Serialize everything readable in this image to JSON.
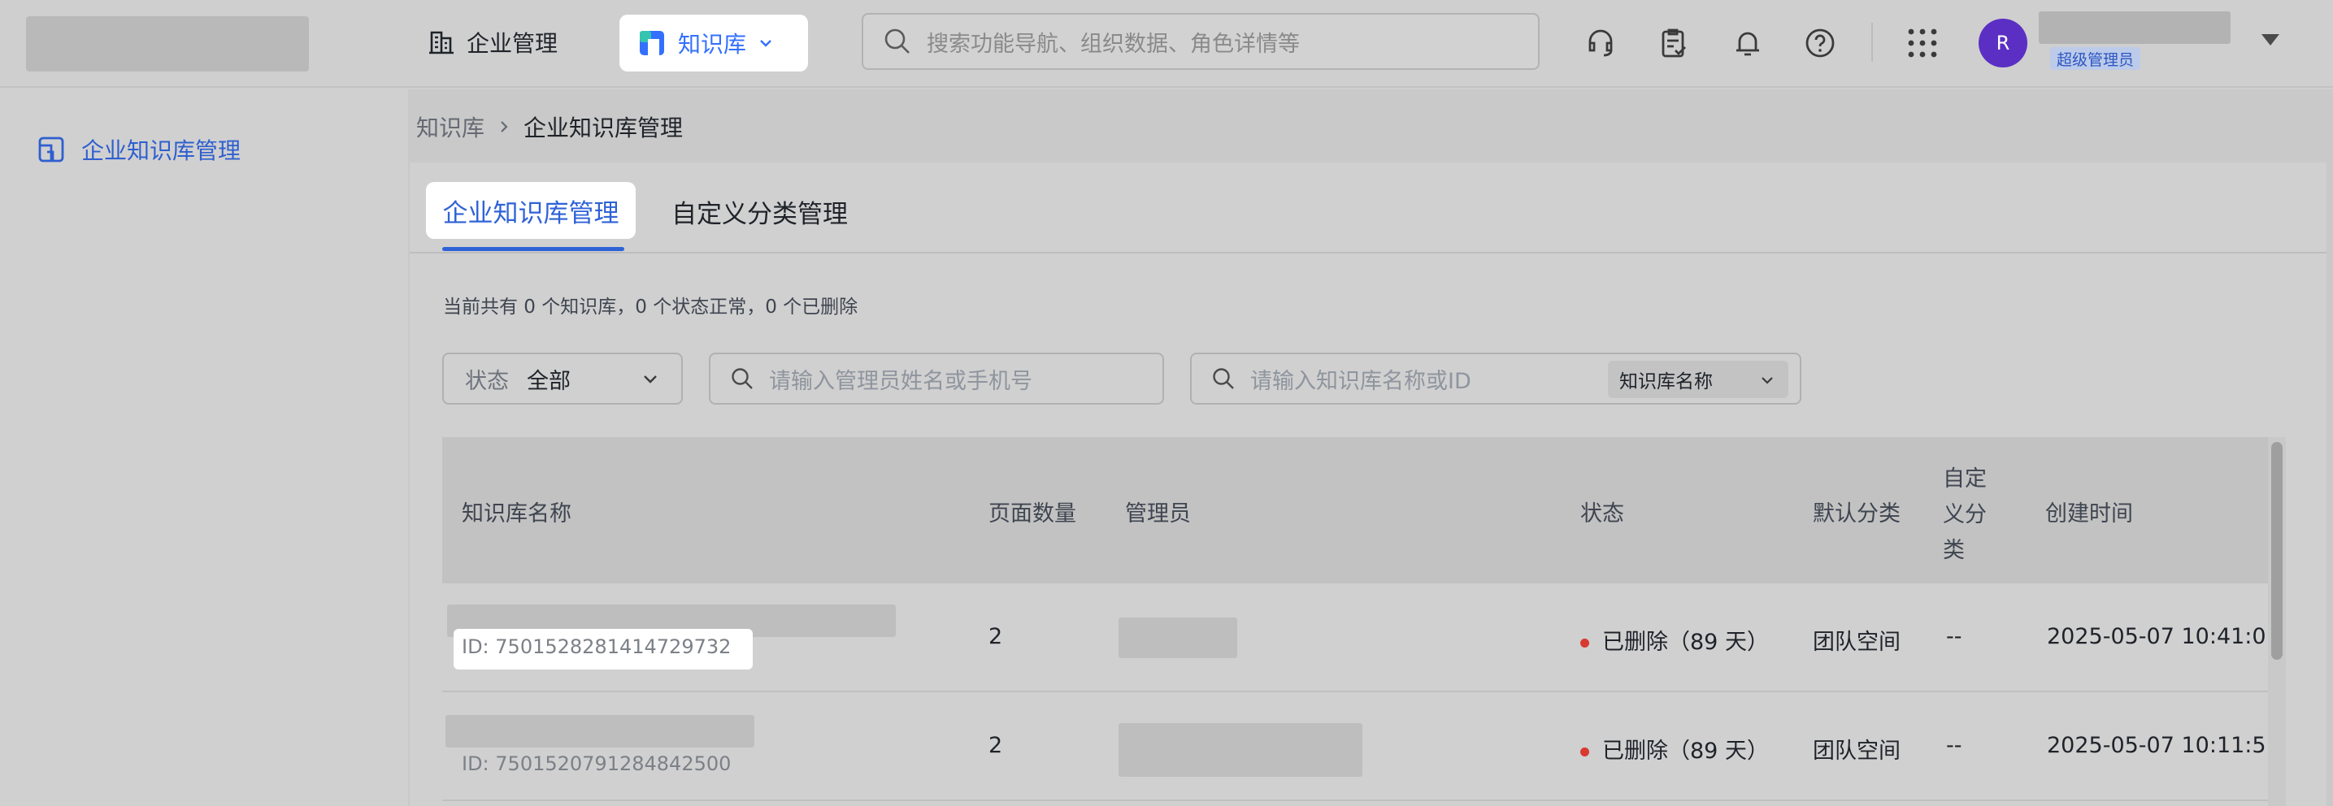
{
  "header": {
    "nav_enterprise": "企业管理",
    "nav_kb": "知识库",
    "search_placeholder": "搜索功能导航、组织数据、角色详情等",
    "avatar_initial": "R",
    "role_badge": "超级管理员",
    "accent_color": "#3370ff"
  },
  "sidebar": {
    "items": [
      {
        "label": "企业知识库管理",
        "icon": "knowledge-base-icon"
      }
    ]
  },
  "breadcrumb": {
    "root": "知识库",
    "current": "企业知识库管理"
  },
  "tabs": [
    {
      "label": "企业知识库管理",
      "active": true
    },
    {
      "label": "自定义分类管理",
      "active": false
    }
  ],
  "summary": "当前共有 0 个知识库，0 个状态正常，0 个已删除",
  "filters": {
    "status_label": "状态",
    "status_value": "全部",
    "admin_placeholder": "请输入管理员姓名或手机号",
    "kb_placeholder": "请输入知识库名称或ID",
    "kb_field_select": "知识库名称"
  },
  "table": {
    "columns": [
      "知识库名称",
      "页面数量",
      "管理员",
      "状态",
      "默认分类",
      "自定义分类",
      "创建时间"
    ],
    "custom_col_lines": [
      "自定",
      "义分",
      "类"
    ],
    "rows": [
      {
        "id": "ID: 7501528281414729732",
        "pages": "2",
        "status": "已删除（89 天）",
        "default_category": "团队空间",
        "custom_category": "--",
        "created": "2025-05-07 10:41:0"
      },
      {
        "id": "ID: 7501520791284842500",
        "pages": "2",
        "status": "已删除（89 天）",
        "default_category": "团队空间",
        "custom_category": "--",
        "created": "2025-05-07 10:11:5"
      }
    ],
    "status_deleted_color": "#d83931"
  }
}
